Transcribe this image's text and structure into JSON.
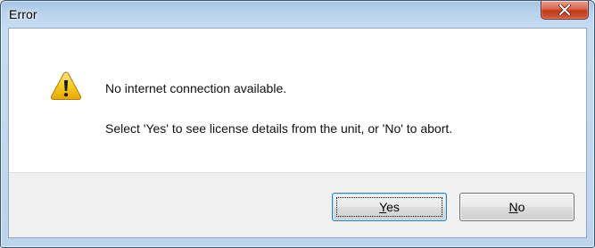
{
  "window": {
    "title": "Error",
    "close_symbol": "x"
  },
  "icon": {
    "name": "warning-icon",
    "color": "#f2c511"
  },
  "message": {
    "line1": "No internet connection available.",
    "line2": "Select 'Yes' to see license details from the unit, or 'No' to abort."
  },
  "buttons": {
    "yes": {
      "mnemonic": "Y",
      "rest": "es",
      "focused": true
    },
    "no": {
      "mnemonic": "N",
      "rest": "o",
      "focused": false
    }
  },
  "colors": {
    "close_button": "#c3371a",
    "focus_border": "#3c7fb1",
    "button_bar": "#f0f0f0"
  }
}
